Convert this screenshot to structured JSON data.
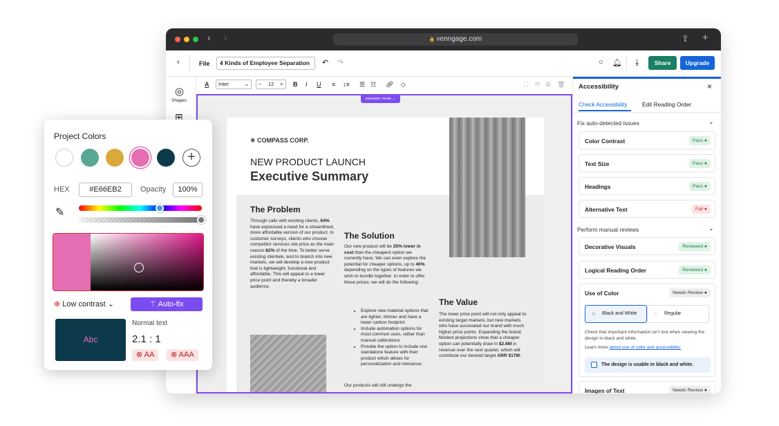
{
  "browser": {
    "url": "venngage.com"
  },
  "appbar": {
    "file": "File",
    "doc_name": "4 Kinds of Employee Separation",
    "share": "Share",
    "upgrade": "Upgrade"
  },
  "leftbar": {
    "shapes": "Shapes"
  },
  "toolbar": {
    "font": "Inter",
    "size": "12"
  },
  "canvas": {
    "simulator": "simulator mode ⌄"
  },
  "doc": {
    "brand": "COMPASS CORP.",
    "headline": "NEW PRODUCT LAUNCH",
    "subheadline": "Executive Summary",
    "problem_title": "The Problem",
    "problem_p1a": "Through calls with existing clients,",
    "problem_p1b": "64%",
    "problem_p1c": " have expressed a need for a streamlined, more affordable version of our product. In customer surveys, clients who choose competitor services cite price as the main reason ",
    "problem_p1d": "82%",
    "problem_p1e": " of the time. To better serve existing clientele, and to branch into new markets, we will develop a new product that is lightweight, functional and affordable. This will appeal to a lower price point and thereby a broader audience.",
    "solution_title": "The Solution",
    "solution_a": "Our new product will be ",
    "solution_b": "25% lower in cost",
    "solution_c": " than the cheapest option we currently have. We can even explore the potential for cheaper options, up to ",
    "solution_d": "40%",
    "solution_e": " depending on the types of features we wish to bundle together. In order to offer these prices, we will do the following:",
    "bullets": [
      "Explore new material options that are lighter, thinner and have a lower carbon footprint",
      "Include automation options for most common uses, rather than manual calibrations",
      "Provide the option to include one standalone feature with their product which allows for personalization and relevance."
    ],
    "solution_tail": "Our products will still undergo the",
    "value_title": "The Value",
    "value_a": "The lower price point will not only appeal to existing target markets, but new markets who have associated our brand with much higher price points. Expanding the brand. Modest projections show that a cheaper option can potentially draw in ",
    "value_b": "$2.6M",
    "value_c": " in revenue over the next quarter, which will contribute our desired target ",
    "value_d": "ARR $17M."
  },
  "panel": {
    "title": "Accessibility",
    "close": "×",
    "tab_check": "Check Accessibility",
    "tab_order": "Edit Reading Order",
    "section_auto": "Fix auto-detected issues",
    "auto_items": [
      {
        "label": "Color Contrast",
        "status": "Pass"
      },
      {
        "label": "Text Size",
        "status": "Pass"
      },
      {
        "label": "Headings",
        "status": "Pass"
      },
      {
        "label": "Alternative Text",
        "status": "Fail"
      }
    ],
    "section_manual": "Perform manual reviews",
    "manual_items": [
      {
        "label": "Decorative Visuals",
        "status": "Reviewed"
      },
      {
        "label": "Logical Reading Order",
        "status": "Reviewed"
      }
    ],
    "use_color": {
      "label": "Use of Color",
      "status": "Needs Review",
      "opt_bw": "Black and White",
      "opt_reg": "Regular",
      "desc": "Check that important information isn't lost when viewing the design in black and white.",
      "learn": "Learn more ",
      "link": "about use of color and accessibility.",
      "checkbox": "The design is usable in black and white."
    },
    "images_text": {
      "label": "Images of Text",
      "status": "Needs Review"
    }
  },
  "project_colors": {
    "title": "Project Colors",
    "swatches": [
      "#ffffff",
      "#5aa795",
      "#d9a93b",
      "#e66eb2",
      "#0d3a4a"
    ],
    "hex_label": "HEX",
    "hex_value": "#E66EB2",
    "opacity_label": "Opacity",
    "opacity_value": "100%",
    "hue_position": 0.66,
    "contrast_label": "Low contrast",
    "autofix": "Auto-fix",
    "preview_text": "Abc",
    "preview_bg": "#0d3a4a",
    "preview_fg": "#e66eb2",
    "normal_text": "Normal text",
    "ratio": "2.1 : 1",
    "aa": "AA",
    "aaa": "AAA"
  }
}
